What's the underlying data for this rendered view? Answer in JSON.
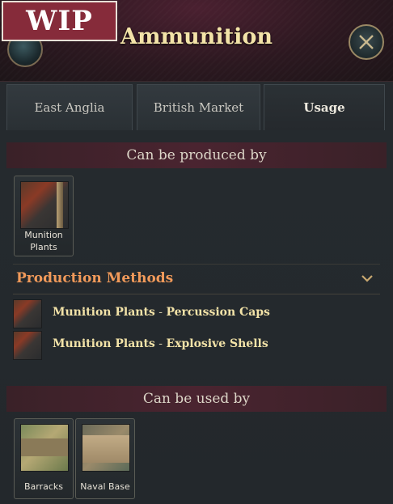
{
  "badge": {
    "label": "WIP"
  },
  "header": {
    "title": "Ammunition"
  },
  "tabs": [
    {
      "label": "East Anglia"
    },
    {
      "label": "British Market"
    },
    {
      "label": "Usage"
    }
  ],
  "active_tab": "Usage",
  "produced_by": {
    "heading": "Can be produced by",
    "buildings": [
      {
        "label": "Munition\nPlants",
        "icon": "ammunition-icon"
      }
    ]
  },
  "production_methods": {
    "title": "Production Methods",
    "items": [
      {
        "building": "Munition Plants",
        "sep": " - ",
        "method": "Percussion Caps",
        "icon": "ammunition-icon"
      },
      {
        "building": "Munition Plants",
        "sep": " - ",
        "method": "Explosive Shells",
        "icon": "ammunition-icon"
      }
    ]
  },
  "used_by": {
    "heading": "Can be used by",
    "buildings": [
      {
        "label": "Barracks",
        "icon": "barracks-icon"
      },
      {
        "label": "Naval Base",
        "icon": "naval-base-icon"
      }
    ]
  },
  "colors": {
    "title": "#f3e3a8",
    "accent": "#f19a5a",
    "section_header_bg": "#4a2430",
    "wip_bg": "#862b3a"
  }
}
